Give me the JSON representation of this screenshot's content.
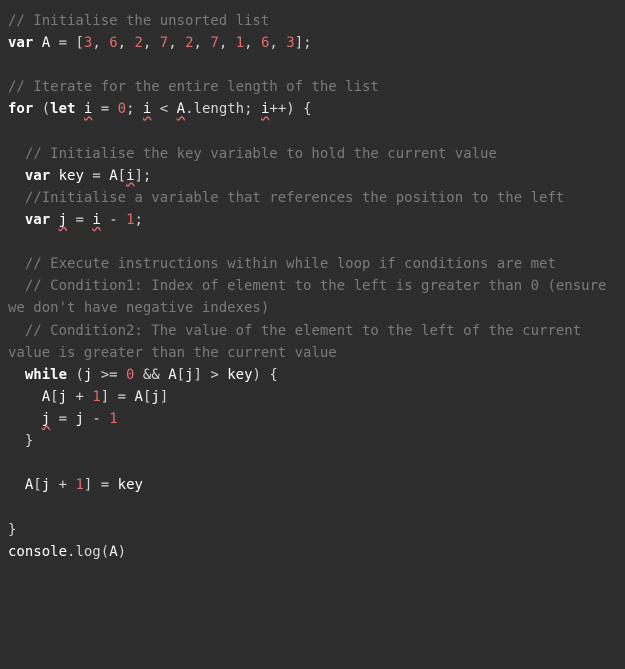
{
  "code": {
    "c1": "// Initialise the unsorted list",
    "kw_var1": "var",
    "A1": "A",
    "eq1": " = [",
    "n1": "3",
    "n2": "6",
    "n3": "2",
    "n4": "7",
    "n5": "2",
    "n6": "7",
    "n7": "1",
    "n8": "6",
    "n9": "3",
    "arr_close": "];",
    "c2": "// Iterate for the entire length of the list",
    "kw_for": "for",
    "for_open": " (",
    "kw_let": "let",
    "i1": "i",
    "eq2": " = ",
    "zero1": "0",
    "semi1": "; ",
    "i2": "i",
    "lt": " < ",
    "A2": "A",
    "dot_len": ".",
    "length_prop": "length",
    "semi2": "; ",
    "i3": "i",
    "pp": "++",
    "for_close": ") {",
    "c3": "// Initialise the key variable to hold the current value",
    "kw_var2": "var",
    "key1": "key",
    "eq3": " = ",
    "A3": "A",
    "br_open1": "[",
    "i4": "i",
    "br_close1": "];",
    "c4": "//Initialise a variable that references the position to the left",
    "kw_var3": "var",
    "j1": "j",
    "eq4": " = ",
    "i5": "i",
    "minus1": " - ",
    "one1": "1",
    "semi3": ";",
    "c5": "// Execute instructions within while loop if conditions are met",
    "c6": "// Condition1: Index of element to the left is greater than 0 (ensure we don't have negative indexes)",
    "c7": "// Condition2: The value of the element to the left of the current value is greater than the current value",
    "kw_while": "while",
    "while_open": " (",
    "j2": "j",
    "ge": " >= ",
    "zero2": "0",
    "and": " && ",
    "A4": "A",
    "br_open2": "[",
    "j3": "j",
    "br_close2": "]",
    "gt": " > ",
    "key2": "key",
    "while_close": ") {",
    "A5": "A",
    "br_open3": "[",
    "j4": "j",
    "plus1": " + ",
    "one2": "1",
    "br_close3": "]",
    "eq5": " = ",
    "A6": "A",
    "br_open4": "[",
    "j5": "j",
    "br_close4": "]",
    "j6": "j",
    "eq6": " = ",
    "j7": "j",
    "minus2": " - ",
    "one3": "1",
    "brace_close1": "}",
    "A7": "A",
    "br_open5": "[",
    "j8": "j",
    "plus2": " + ",
    "one4": "1",
    "br_close5": "]",
    "eq7": " = ",
    "key3": "key",
    "brace_close2": "}",
    "console": "console",
    "dot_log": ".",
    "log": "log",
    "paren_open": "(",
    "A8": "A",
    "paren_close": ")"
  }
}
